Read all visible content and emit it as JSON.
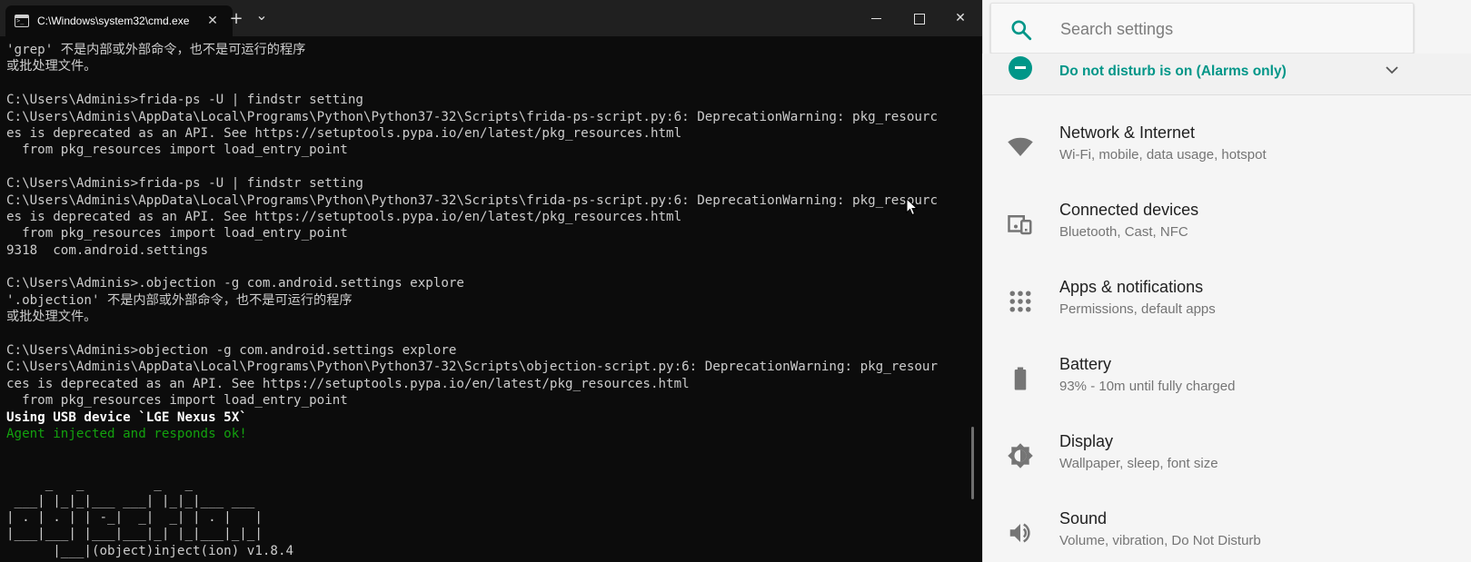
{
  "terminal": {
    "tab_title": "C:\\Windows\\system32\\cmd.exe",
    "tab_close": "✕",
    "new_tab": "+",
    "dropdown": "⌄",
    "close": "✕",
    "lines": [
      {
        "text": "'grep' 不是内部或外部命令，也不是可运行的程序",
        "style": "normal"
      },
      {
        "text": "或批处理文件。",
        "style": "normal"
      },
      {
        "text": "",
        "style": "normal"
      },
      {
        "text": "C:\\Users\\Adminis>frida-ps -U | findstr setting",
        "style": "normal"
      },
      {
        "text": "C:\\Users\\Adminis\\AppData\\Local\\Programs\\Python\\Python37-32\\Scripts\\frida-ps-script.py:6: DeprecationWarning: pkg_resourc",
        "style": "normal"
      },
      {
        "text": "es is deprecated as an API. See https://setuptools.pypa.io/en/latest/pkg_resources.html",
        "style": "normal"
      },
      {
        "text": "  from pkg_resources import load_entry_point",
        "style": "normal"
      },
      {
        "text": "",
        "style": "normal"
      },
      {
        "text": "C:\\Users\\Adminis>frida-ps -U | findstr setting",
        "style": "normal"
      },
      {
        "text": "C:\\Users\\Adminis\\AppData\\Local\\Programs\\Python\\Python37-32\\Scripts\\frida-ps-script.py:6: DeprecationWarning: pkg_resourc",
        "style": "normal"
      },
      {
        "text": "es is deprecated as an API. See https://setuptools.pypa.io/en/latest/pkg_resources.html",
        "style": "normal"
      },
      {
        "text": "  from pkg_resources import load_entry_point",
        "style": "normal"
      },
      {
        "text": "9318  com.android.settings",
        "style": "normal"
      },
      {
        "text": "",
        "style": "normal"
      },
      {
        "text": "C:\\Users\\Adminis>.objection -g com.android.settings explore",
        "style": "normal"
      },
      {
        "text": "'.objection' 不是内部或外部命令，也不是可运行的程序",
        "style": "normal"
      },
      {
        "text": "或批处理文件。",
        "style": "normal"
      },
      {
        "text": "",
        "style": "normal"
      },
      {
        "text": "C:\\Users\\Adminis>objection -g com.android.settings explore",
        "style": "normal"
      },
      {
        "text": "C:\\Users\\Adminis\\AppData\\Local\\Programs\\Python\\Python37-32\\Scripts\\objection-script.py:6: DeprecationWarning: pkg_resour",
        "style": "normal"
      },
      {
        "text": "ces is deprecated as an API. See https://setuptools.pypa.io/en/latest/pkg_resources.html",
        "style": "normal"
      },
      {
        "text": "  from pkg_resources import load_entry_point",
        "style": "normal"
      },
      {
        "text": "Using USB device `LGE Nexus 5X`",
        "style": "bold"
      },
      {
        "text": "Agent injected and responds ok!",
        "style": "green"
      },
      {
        "text": "",
        "style": "normal"
      },
      {
        "text": "",
        "style": "normal"
      },
      {
        "text": "     _   _         _   _",
        "style": "normal"
      },
      {
        "text": " ___| |_|_|___ ___| |_|_|___ ___",
        "style": "normal"
      },
      {
        "text": "| . | . | | -_|  _|  _| | . |   |",
        "style": "normal"
      },
      {
        "text": "|___|___| |___|___|_| |_|___|_|_|",
        "style": "normal"
      },
      {
        "text": "      |___|(object)inject(ion) v1.8.4",
        "style": "normal"
      }
    ]
  },
  "settings": {
    "search_placeholder": "Search settings",
    "dnd_text": "Do not disturb is on (Alarms only)",
    "accent_color": "#009688",
    "items": [
      {
        "title": "Network & Internet",
        "subtitle": "Wi-Fi, mobile, data usage, hotspot",
        "icon": "wifi-icon"
      },
      {
        "title": "Connected devices",
        "subtitle": "Bluetooth, Cast, NFC",
        "icon": "devices-icon"
      },
      {
        "title": "Apps & notifications",
        "subtitle": "Permissions, default apps",
        "icon": "apps-icon"
      },
      {
        "title": "Battery",
        "subtitle": "93% - 10m until fully charged",
        "icon": "battery-icon"
      },
      {
        "title": "Display",
        "subtitle": "Wallpaper, sleep, font size",
        "icon": "brightness-icon"
      },
      {
        "title": "Sound",
        "subtitle": "Volume, vibration, Do Not Disturb",
        "icon": "volume-icon"
      }
    ]
  }
}
